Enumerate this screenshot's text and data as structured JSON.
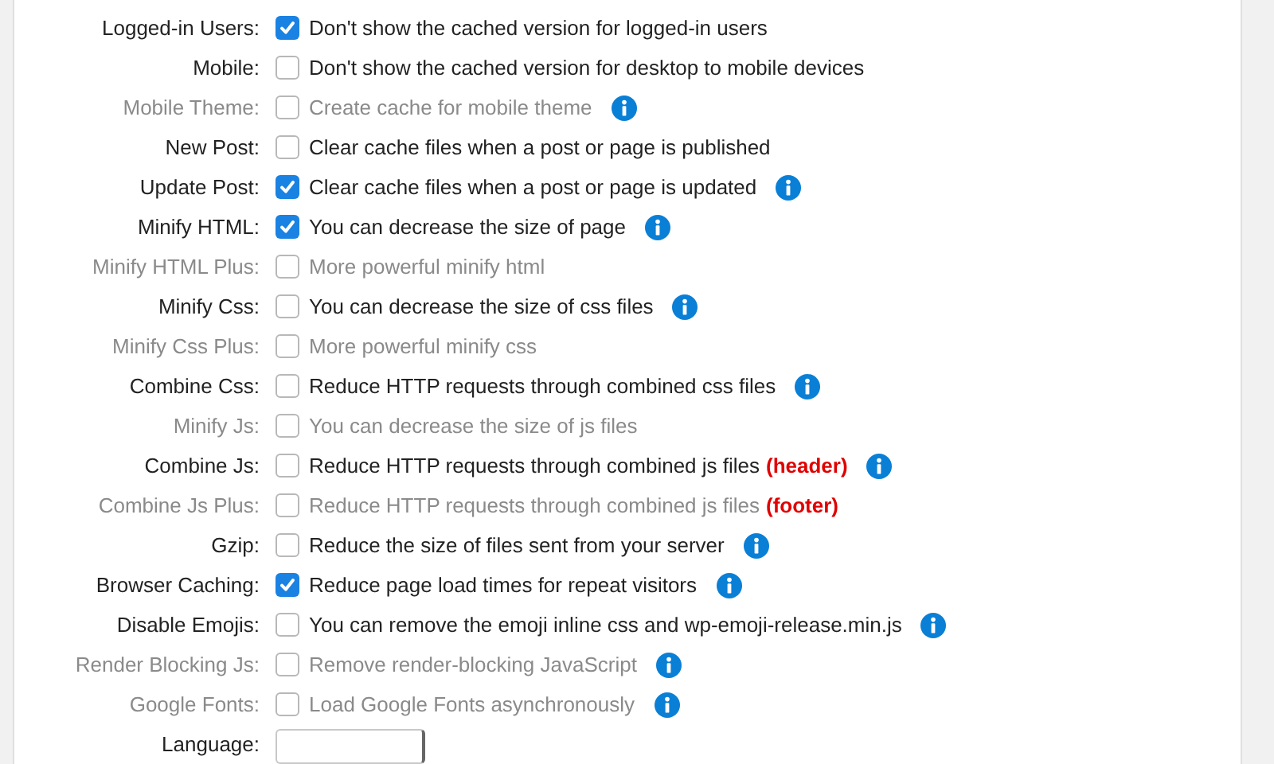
{
  "settings": [
    {
      "label": "Logged-in Users:",
      "text": "Don't show the cached version for logged-in users",
      "checked": true,
      "disabled": false,
      "info": false
    },
    {
      "label": "Mobile:",
      "text": "Don't show the cached version for desktop to mobile devices",
      "checked": false,
      "disabled": false,
      "info": false
    },
    {
      "label": "Mobile Theme:",
      "text": "Create cache for mobile theme",
      "checked": false,
      "disabled": true,
      "info": true
    },
    {
      "label": "New Post:",
      "text": "Clear cache files when a post or page is published",
      "checked": false,
      "disabled": false,
      "info": false
    },
    {
      "label": "Update Post:",
      "text": "Clear cache files when a post or page is updated",
      "checked": true,
      "disabled": false,
      "info": true
    },
    {
      "label": "Minify HTML:",
      "text": "You can decrease the size of page",
      "checked": true,
      "disabled": false,
      "info": true
    },
    {
      "label": "Minify HTML Plus:",
      "text": "More powerful minify html",
      "checked": false,
      "disabled": true,
      "info": false
    },
    {
      "label": "Minify Css:",
      "text": "You can decrease the size of css files",
      "checked": false,
      "disabled": false,
      "info": true
    },
    {
      "label": "Minify Css Plus:",
      "text": "More powerful minify css",
      "checked": false,
      "disabled": true,
      "info": false
    },
    {
      "label": "Combine Css:",
      "text": "Reduce HTTP requests through combined css files",
      "checked": false,
      "disabled": false,
      "info": true
    },
    {
      "label": "Minify Js:",
      "text": "You can decrease the size of js files",
      "checked": false,
      "disabled": true,
      "info": false
    },
    {
      "label": "Combine Js:",
      "text": "Reduce HTTP requests through combined js files",
      "note": "(header)",
      "checked": false,
      "disabled": false,
      "info": true
    },
    {
      "label": "Combine Js Plus:",
      "text": "Reduce HTTP requests through combined js files",
      "note": "(footer)",
      "checked": false,
      "disabled": true,
      "info": false
    },
    {
      "label": "Gzip:",
      "text": "Reduce the size of files sent from your server",
      "checked": false,
      "disabled": false,
      "info": true
    },
    {
      "label": "Browser Caching:",
      "text": "Reduce page load times for repeat visitors",
      "checked": true,
      "disabled": false,
      "info": true
    },
    {
      "label": "Disable Emojis:",
      "text": "You can remove the emoji inline css and wp-emoji-release.min.js",
      "checked": false,
      "disabled": false,
      "info": true
    },
    {
      "label": "Render Blocking Js:",
      "text": "Remove render-blocking JavaScript",
      "checked": false,
      "disabled": true,
      "info": true
    },
    {
      "label": "Google Fonts:",
      "text": "Load Google Fonts asynchronously",
      "checked": false,
      "disabled": true,
      "info": true
    }
  ],
  "language": {
    "label": "Language:"
  }
}
